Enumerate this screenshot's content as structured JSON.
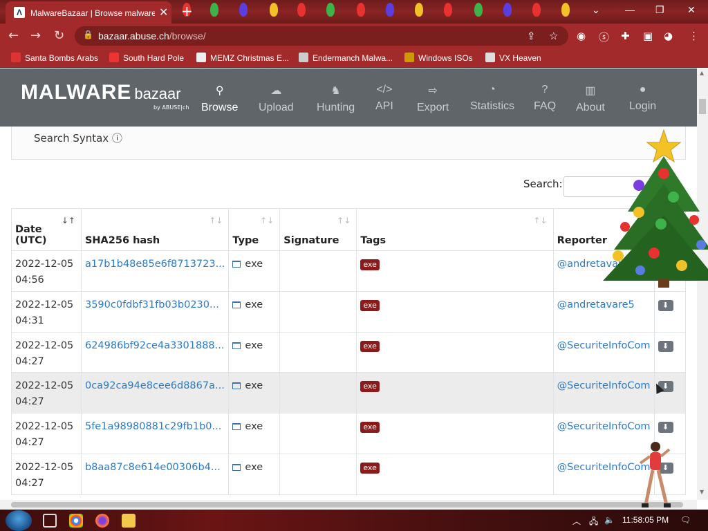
{
  "browser": {
    "tab_title": "MalwareBazaar | Browse malware",
    "url_host": "bazaar.abuse.ch",
    "url_path": "/browse/",
    "bookmarks": [
      {
        "label": "Santa Bombs Arabs",
        "icon": "santa-icon",
        "color": "#d33"
      },
      {
        "label": "South Hard Pole",
        "icon": "star-icon",
        "color": "#e33"
      },
      {
        "label": "MEMZ Christmas E...",
        "icon": "page-icon",
        "color": "#eee"
      },
      {
        "label": "Endermanch Malwa...",
        "icon": "skull-icon",
        "color": "#ccc"
      },
      {
        "label": "Windows ISOs",
        "icon": "figure-icon",
        "color": "#c90"
      },
      {
        "label": "VX Heaven",
        "icon": "vx-icon",
        "color": "#ddd"
      }
    ]
  },
  "site": {
    "logo_main": "MALWARE",
    "logo_sub": "bazaar",
    "logo_by": "by ABUSE|ch",
    "nav": [
      {
        "label": "Browse",
        "icon": "search-icon",
        "glyph": "🔍",
        "active": true
      },
      {
        "label": "Upload",
        "icon": "upload-cloud-icon",
        "glyph": "☁",
        "active": false
      },
      {
        "label": "Hunting",
        "icon": "cat-icon",
        "glyph": "🐈",
        "active": false
      },
      {
        "label": "API",
        "icon": "code-icon",
        "glyph": "</>",
        "active": false
      },
      {
        "label": "Export",
        "icon": "export-icon",
        "glyph": "⇨",
        "active": false
      },
      {
        "label": "Statistics",
        "icon": "pie-chart-icon",
        "glyph": "◔",
        "active": false
      },
      {
        "label": "FAQ",
        "icon": "question-icon",
        "glyph": "?",
        "active": false
      },
      {
        "label": "About",
        "icon": "building-icon",
        "glyph": "▥",
        "active": false
      },
      {
        "label": "Login",
        "icon": "user-icon",
        "glyph": "●",
        "active": false
      }
    ]
  },
  "search_syntax_label": "Search Syntax",
  "search_label": "Search:",
  "search_value": "",
  "table": {
    "columns": [
      "Date (UTC)",
      "SHA256 hash",
      "Type",
      "Signature",
      "Tags",
      "Reporter",
      ""
    ],
    "col_date_line1": "Date",
    "col_date_line2": "(UTC)",
    "rows": [
      {
        "date": "2022-12-05",
        "time": "04:56",
        "hash": "a17b1b48e85e6f8713723...",
        "type": "exe",
        "signature": "",
        "tag": "exe",
        "reporter": "@andretavare5"
      },
      {
        "date": "2022-12-05",
        "time": "04:31",
        "hash": "3590c0fdbf31fb03b0230...",
        "type": "exe",
        "signature": "",
        "tag": "exe",
        "reporter": "@andretavare5"
      },
      {
        "date": "2022-12-05",
        "time": "04:27",
        "hash": "624986bf92ce4a3301888...",
        "type": "exe",
        "signature": "",
        "tag": "exe",
        "reporter": "@SecuriteInfoCom"
      },
      {
        "date": "2022-12-05",
        "time": "04:27",
        "hash": "0ca92ca94e8cee6d8867a...",
        "type": "exe",
        "signature": "",
        "tag": "exe",
        "reporter": "@SecuriteInfoCom",
        "highlight": true
      },
      {
        "date": "2022-12-05",
        "time": "04:27",
        "hash": "5fe1a98980881c29fb1b0...",
        "type": "exe",
        "signature": "",
        "tag": "exe",
        "reporter": "@SecuriteInfoCom"
      },
      {
        "date": "2022-12-05",
        "time": "04:27",
        "hash": "b8aa87c8e614e00306b4...",
        "type": "exe",
        "signature": "",
        "tag": "exe",
        "reporter": "@SecuriteInfoCom"
      }
    ]
  },
  "taskbar": {
    "clock": "11:58:05 PM"
  },
  "colors": {
    "chrome_red": "#a32a2a",
    "header_gray": "#5f6569",
    "link_blue": "#2a7ac8",
    "tag_red": "#8b1a1a"
  }
}
